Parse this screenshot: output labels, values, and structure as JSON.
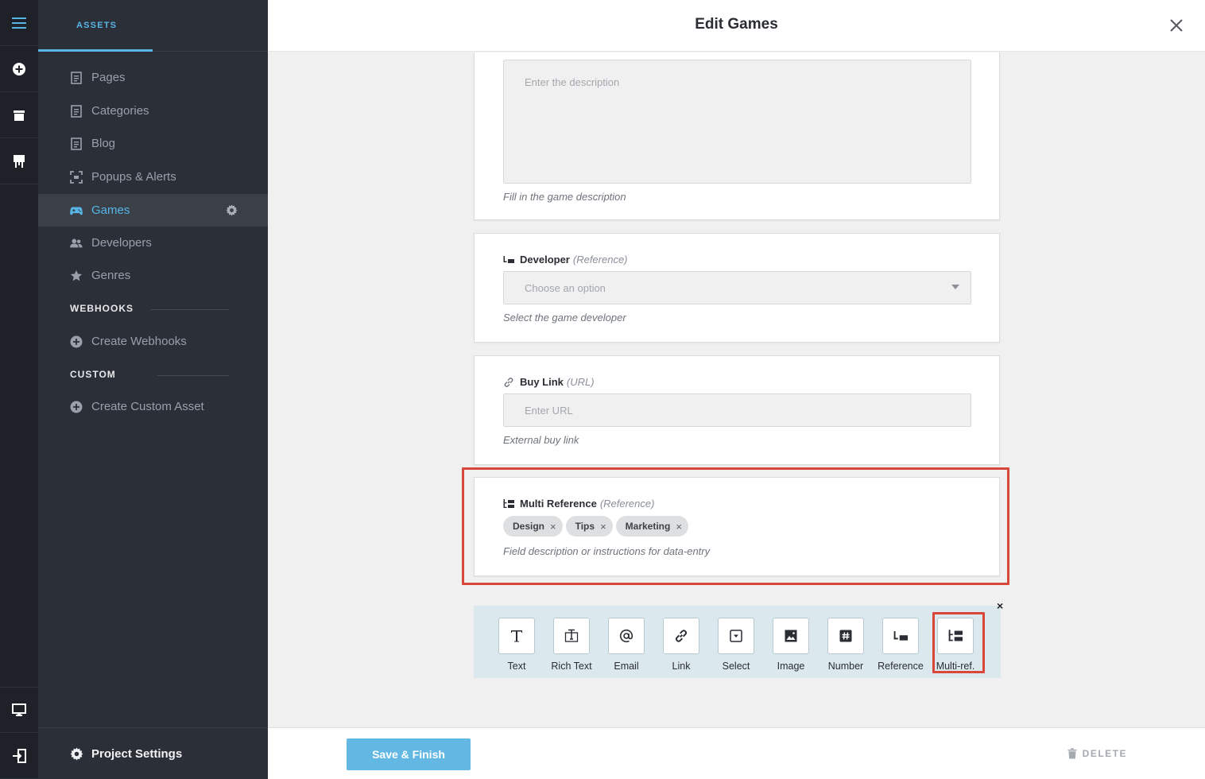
{
  "sidebar": {
    "tab_label": "ASSETS",
    "items": [
      {
        "label": "Pages"
      },
      {
        "label": "Categories"
      },
      {
        "label": "Blog"
      },
      {
        "label": "Popups & Alerts"
      },
      {
        "label": "Games"
      },
      {
        "label": "Developers"
      },
      {
        "label": "Genres"
      }
    ],
    "webhooks_section": "WEBHOOKS",
    "create_webhooks": "Create Webhooks",
    "custom_section": "CUSTOM",
    "create_custom_asset": "Create Custom Asset",
    "project_settings": "Project Settings"
  },
  "header": {
    "title": "Edit Games"
  },
  "fields": {
    "description": {
      "placeholder": "Enter the description",
      "help": "Fill in the game description"
    },
    "developer": {
      "name": "Developer",
      "type": "(Reference)",
      "placeholder": "Choose an option",
      "help": "Select the game developer"
    },
    "buy_link": {
      "name": "Buy Link",
      "type": "(URL)",
      "placeholder": "Enter URL",
      "help": "External buy link"
    },
    "multi_reference": {
      "name": "Multi Reference",
      "type": "(Reference)",
      "tags": [
        "Design",
        "Tips",
        "Marketing"
      ],
      "tag_remove": "×",
      "help": "Field description or instructions for data-entry"
    }
  },
  "picker": {
    "close": "×",
    "types": [
      "Text",
      "Rich Text",
      "Email",
      "Link",
      "Select",
      "Image",
      "Number",
      "Reference",
      "Multi-ref."
    ]
  },
  "footer": {
    "save_label": "Save & Finish",
    "delete_label": "DELETE"
  },
  "colors": {
    "accent": "#57b6e6",
    "highlight": "#d9463a",
    "save_button": "#62b8e3"
  }
}
